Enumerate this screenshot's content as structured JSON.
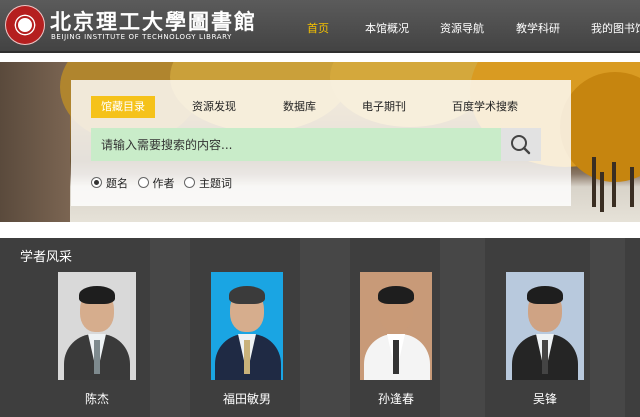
{
  "header": {
    "library_name": "北京理工大學圖書館",
    "library_name_en": "BEIJING INSTITUTE OF TECHNOLOGY LIBRARY",
    "nav": [
      "首页",
      "本馆概况",
      "资源导航",
      "教学科研",
      "我的图书馆"
    ],
    "active_nav": "首页",
    "accent_color": "#f5c100"
  },
  "search": {
    "tabs": [
      "馆藏目录",
      "资源发现",
      "数据库",
      "电子期刊",
      "百度学术搜索"
    ],
    "active_tab": "馆藏目录",
    "placeholder": "请输入需要搜索的内容...",
    "button_icon": "search-icon",
    "options": [
      "题名",
      "作者",
      "主题词"
    ],
    "selected_option": "题名"
  },
  "scholars": {
    "title": "学者风采",
    "people": [
      "陈杰",
      "福田敏男",
      "孙逢春",
      "吴锋"
    ]
  }
}
